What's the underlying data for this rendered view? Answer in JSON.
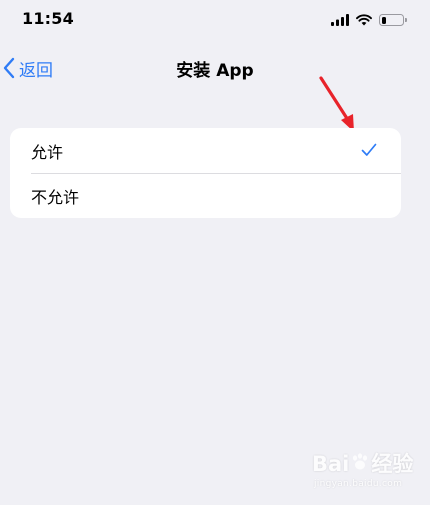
{
  "status_bar": {
    "time": "11:54",
    "icons": [
      "signal-icon",
      "wifi-icon",
      "battery-icon"
    ],
    "battery_level": 0.25
  },
  "nav": {
    "back_label": "返回",
    "title": "安装 App"
  },
  "options": [
    {
      "label": "允许",
      "selected": true
    },
    {
      "label": "不允许",
      "selected": false
    }
  ],
  "watermark": {
    "brand_left": "Bai",
    "brand_right": "经验",
    "url": "jingyan.baidu.com"
  },
  "colors": {
    "accent": "#2f7cf6",
    "background": "#f0f0f5",
    "annotation": "#e8232a"
  }
}
